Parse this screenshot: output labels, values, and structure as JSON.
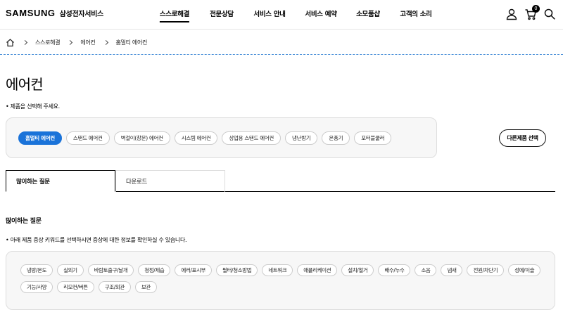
{
  "header": {
    "logo_main": "SAMSUNG",
    "logo_sub": "삼성전자서비스",
    "nav": [
      "스스로해결",
      "전문상담",
      "서비스 안내",
      "서비스 예약",
      "소모품샵",
      "고객의 소리"
    ],
    "active_nav": "스스로해결",
    "cart_count": "0"
  },
  "breadcrumb": [
    "스스로해결",
    "에어컨",
    "홈멀티 에어컨"
  ],
  "page": {
    "title": "에어컨",
    "select_message": "• 제품을 선택해 주세요."
  },
  "products": {
    "chips": [
      "홈멀티 에어컨",
      "스탠드 에어컨",
      "벽걸이(창문) 에어컨",
      "시스템 에어컨",
      "상업용 스탠드 에어컨",
      "냉난방기",
      "온풍기",
      "포터블쿨러"
    ],
    "active": "홈멀티 에어컨",
    "other_button": "다른제품 선택"
  },
  "tabs": {
    "active": "많이하는 질문",
    "inactive": "다운로드"
  },
  "faq": {
    "title": "많이하는 질문",
    "keyword_message": "• 아래 제품 증상 키워드를 선택하시면 증상에 대한 정보를 확인하실 수 있습니다.",
    "keywords": [
      "냉방/온도",
      "실외기",
      "바람토출구/날개",
      "청정/제습",
      "에러/표시부",
      "필터/청소방법",
      "네트워크",
      "애플리케이션",
      "설치/철거",
      "배수/누수",
      "소음",
      "냄새",
      "전원/차단기",
      "성에/이슬",
      "기능/사양",
      "리모컨/버튼",
      "구조/외관",
      "보관"
    ]
  },
  "colors": {
    "accent": "#1a73d9",
    "dashed_divider": "#4a90d9"
  }
}
